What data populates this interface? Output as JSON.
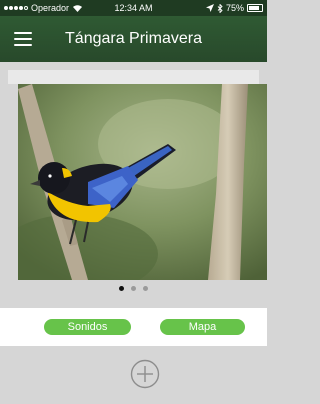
{
  "status": {
    "carrier": "Operador",
    "time": "12:34 AM",
    "battery": "75%"
  },
  "header": {
    "title": "Tángara Primavera"
  },
  "gallery": {
    "page_count": 3,
    "active_index": 0
  },
  "actions": {
    "sounds_label": "Sonidos",
    "map_label": "Mapa"
  },
  "colors": {
    "nav": "#2b4f2e",
    "accent": "#67c34a"
  },
  "icons": {
    "menu": "hamburger-icon",
    "add": "plus-circle-icon",
    "wifi": "wifi-icon",
    "location": "location-arrow-icon",
    "bluetooth": "bluetooth-icon",
    "battery": "battery-icon"
  }
}
